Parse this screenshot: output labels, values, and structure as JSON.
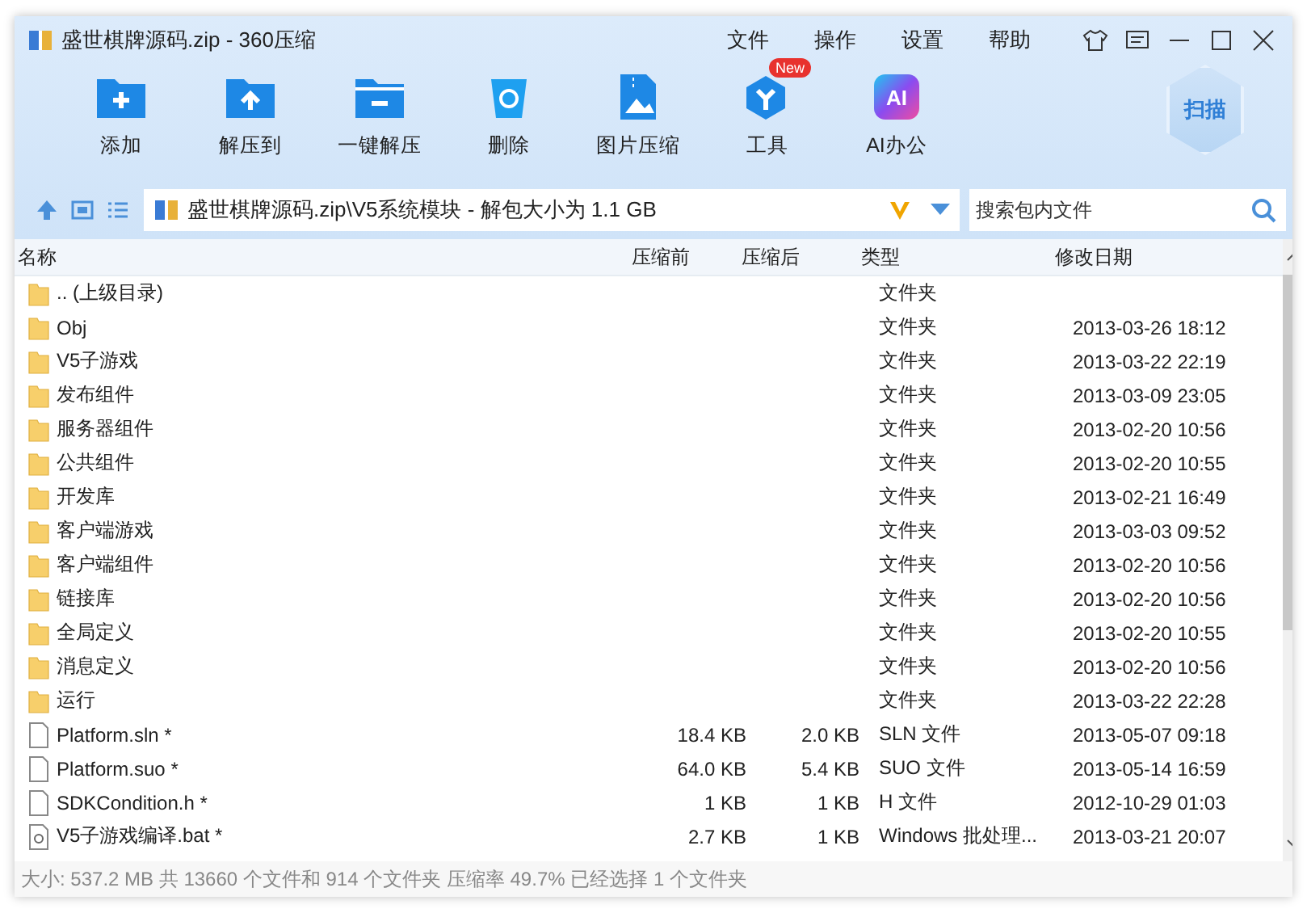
{
  "window": {
    "title": "盛世棋牌源码.zip - 360压缩"
  },
  "menu": [
    "文件",
    "操作",
    "设置",
    "帮助"
  ],
  "toolbar": [
    {
      "kind": "add",
      "label": "添加"
    },
    {
      "kind": "extract-to",
      "label": "解压到"
    },
    {
      "kind": "one-click",
      "label": "一键解压"
    },
    {
      "kind": "delete",
      "label": "删除"
    },
    {
      "kind": "image",
      "label": "图片压缩"
    },
    {
      "kind": "tools",
      "label": "工具",
      "badge": "New"
    },
    {
      "kind": "ai",
      "label": "AI办公",
      "icon_text": "AI"
    }
  ],
  "scan_button": "扫描",
  "address": {
    "path": "盛世棋牌源码.zip\\V5系统模块 - 解包大小为 1.1 GB"
  },
  "search": {
    "placeholder": "搜索包内文件"
  },
  "table": {
    "columns": [
      "名称",
      "压缩前",
      "压缩后",
      "类型",
      "修改日期"
    ],
    "rows": [
      {
        "kind": "folder",
        "name": ".. (上级目录)",
        "size": "",
        "packed": "",
        "type": "文件夹",
        "date": ""
      },
      {
        "kind": "folder",
        "name": "Obj",
        "size": "",
        "packed": "",
        "type": "文件夹",
        "date": "2013-03-26 18:12"
      },
      {
        "kind": "folder",
        "name": "V5子游戏",
        "size": "",
        "packed": "",
        "type": "文件夹",
        "date": "2013-03-22 22:19"
      },
      {
        "kind": "folder",
        "name": "发布组件",
        "size": "",
        "packed": "",
        "type": "文件夹",
        "date": "2013-03-09 23:05"
      },
      {
        "kind": "folder",
        "name": "服务器组件",
        "size": "",
        "packed": "",
        "type": "文件夹",
        "date": "2013-02-20 10:56"
      },
      {
        "kind": "folder",
        "name": "公共组件",
        "size": "",
        "packed": "",
        "type": "文件夹",
        "date": "2013-02-20 10:55"
      },
      {
        "kind": "folder",
        "name": "开发库",
        "size": "",
        "packed": "",
        "type": "文件夹",
        "date": "2013-02-21 16:49"
      },
      {
        "kind": "folder",
        "name": "客户端游戏",
        "size": "",
        "packed": "",
        "type": "文件夹",
        "date": "2013-03-03 09:52"
      },
      {
        "kind": "folder",
        "name": "客户端组件",
        "size": "",
        "packed": "",
        "type": "文件夹",
        "date": "2013-02-20 10:56"
      },
      {
        "kind": "folder",
        "name": "链接库",
        "size": "",
        "packed": "",
        "type": "文件夹",
        "date": "2013-02-20 10:56"
      },
      {
        "kind": "folder",
        "name": "全局定义",
        "size": "",
        "packed": "",
        "type": "文件夹",
        "date": "2013-02-20 10:55"
      },
      {
        "kind": "folder",
        "name": "消息定义",
        "size": "",
        "packed": "",
        "type": "文件夹",
        "date": "2013-02-20 10:56"
      },
      {
        "kind": "folder",
        "name": "运行",
        "size": "",
        "packed": "",
        "type": "文件夹",
        "date": "2013-03-22 22:28"
      },
      {
        "kind": "file",
        "name": "Platform.sln *",
        "size": "18.4 KB",
        "packed": "2.0 KB",
        "type": "SLN 文件",
        "date": "2013-05-07 09:18"
      },
      {
        "kind": "file",
        "name": "Platform.suo *",
        "size": "64.0 KB",
        "packed": "5.4 KB",
        "type": "SUO 文件",
        "date": "2013-05-14 16:59"
      },
      {
        "kind": "file",
        "name": "SDKCondition.h *",
        "size": "1 KB",
        "packed": "1 KB",
        "type": "H 文件",
        "date": "2012-10-29 01:03"
      },
      {
        "kind": "batch",
        "name": "V5子游戏编译.bat *",
        "size": "2.7 KB",
        "packed": "1 KB",
        "type": "Windows 批处理...",
        "date": "2013-03-21 20:07"
      }
    ]
  },
  "status_bar": "大小: 537.2 MB 共 13660 个文件和 914 个文件夹 压缩率 49.7% 已经选择 1 个文件夹"
}
